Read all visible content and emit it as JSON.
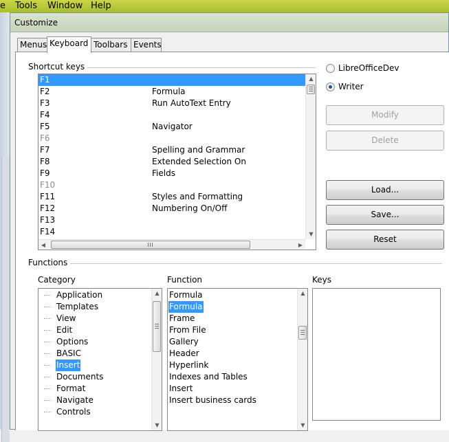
{
  "menubar": {
    "items": [
      {
        "label": "e"
      },
      {
        "label": "Tools"
      },
      {
        "label": "Window"
      },
      {
        "label": "Help"
      }
    ]
  },
  "dialog": {
    "title": "Customize",
    "tabs": [
      {
        "label": "Menus"
      },
      {
        "label": "Keyboard",
        "active": true
      },
      {
        "label": "Toolbars"
      },
      {
        "label": "Events"
      }
    ]
  },
  "shortcut_keys": {
    "label": "Shortcut keys",
    "rows": [
      {
        "key": "F1",
        "function": "",
        "state": "selected"
      },
      {
        "key": "F2",
        "function": "Formula"
      },
      {
        "key": "F3",
        "function": "Run AutoText Entry"
      },
      {
        "key": "F4",
        "function": ""
      },
      {
        "key": "F5",
        "function": "Navigator"
      },
      {
        "key": "F6",
        "function": "",
        "state": "dim"
      },
      {
        "key": "F7",
        "function": "Spelling and Grammar"
      },
      {
        "key": "F8",
        "function": "Extended Selection On"
      },
      {
        "key": "F9",
        "function": "Fields"
      },
      {
        "key": "F10",
        "function": "",
        "state": "dim"
      },
      {
        "key": "F11",
        "function": "Styles and Formatting"
      },
      {
        "key": "F12",
        "function": "Numbering On/Off"
      },
      {
        "key": "F13",
        "function": ""
      },
      {
        "key": "F14",
        "function": ""
      }
    ]
  },
  "scope": {
    "options": [
      {
        "label": "LibreOfficeDev",
        "selected": false
      },
      {
        "label": "Writer",
        "selected": true
      }
    ]
  },
  "buttons": {
    "modify": "Modify",
    "delete": "Delete",
    "load": "Load...",
    "save": "Save...",
    "reset": "Reset"
  },
  "functions": {
    "label": "Functions",
    "category_label": "Category",
    "function_label": "Function",
    "keys_label": "Keys",
    "categories": [
      "Application",
      "Templates",
      "View",
      "Edit",
      "Options",
      "BASIC",
      "Insert",
      "Documents",
      "Format",
      "Navigate",
      "Controls"
    ],
    "selected_category": "Insert",
    "function_items": [
      "Formula",
      "Formula",
      "Frame",
      "From File",
      "Gallery",
      "Header",
      "Hyperlink",
      "Indexes and Tables",
      "Insert",
      "Insert business cards"
    ],
    "selected_function_index": 1
  }
}
